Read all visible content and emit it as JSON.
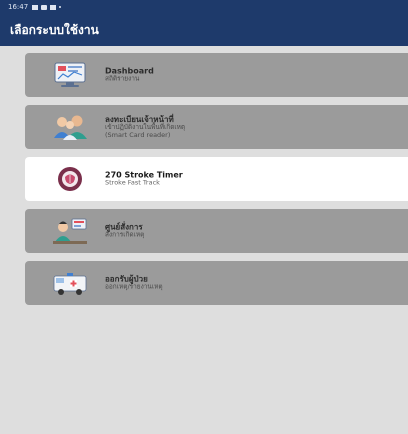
{
  "status_bar": {
    "time": "16:47"
  },
  "app_bar": {
    "title": "เลือกระบบใช้งาน"
  },
  "colors": {
    "header": "#1e3a6b",
    "card": "#9b9b9b",
    "card_active": "#ffffff"
  },
  "menu": [
    {
      "title": "Dashboard",
      "subtitle": "สถิติรายงาน",
      "icon": "monitor-dashboard-icon",
      "active": false
    },
    {
      "title": "ลงทะเบียนเจ้าหน้าที่",
      "subtitle": "เข้าปฏิบัติงานในพื้นที่เกิดเหตุ",
      "subtitle2": "(Smart Card reader)",
      "icon": "staff-registration-icon",
      "active": false
    },
    {
      "title": "270 Stroke Timer",
      "subtitle": "Stroke Fast Track",
      "icon": "stroke-timer-icon",
      "active": true
    },
    {
      "title": "ศูนย์สั่งการ",
      "subtitle": "สั่งการเกิดเหตุ",
      "icon": "command-center-icon",
      "active": false
    },
    {
      "title": "ออกรับผู้ป่วย",
      "subtitle": "ออกเหตุ/รายงานเหตุ",
      "icon": "ambulance-icon",
      "active": false
    }
  ]
}
